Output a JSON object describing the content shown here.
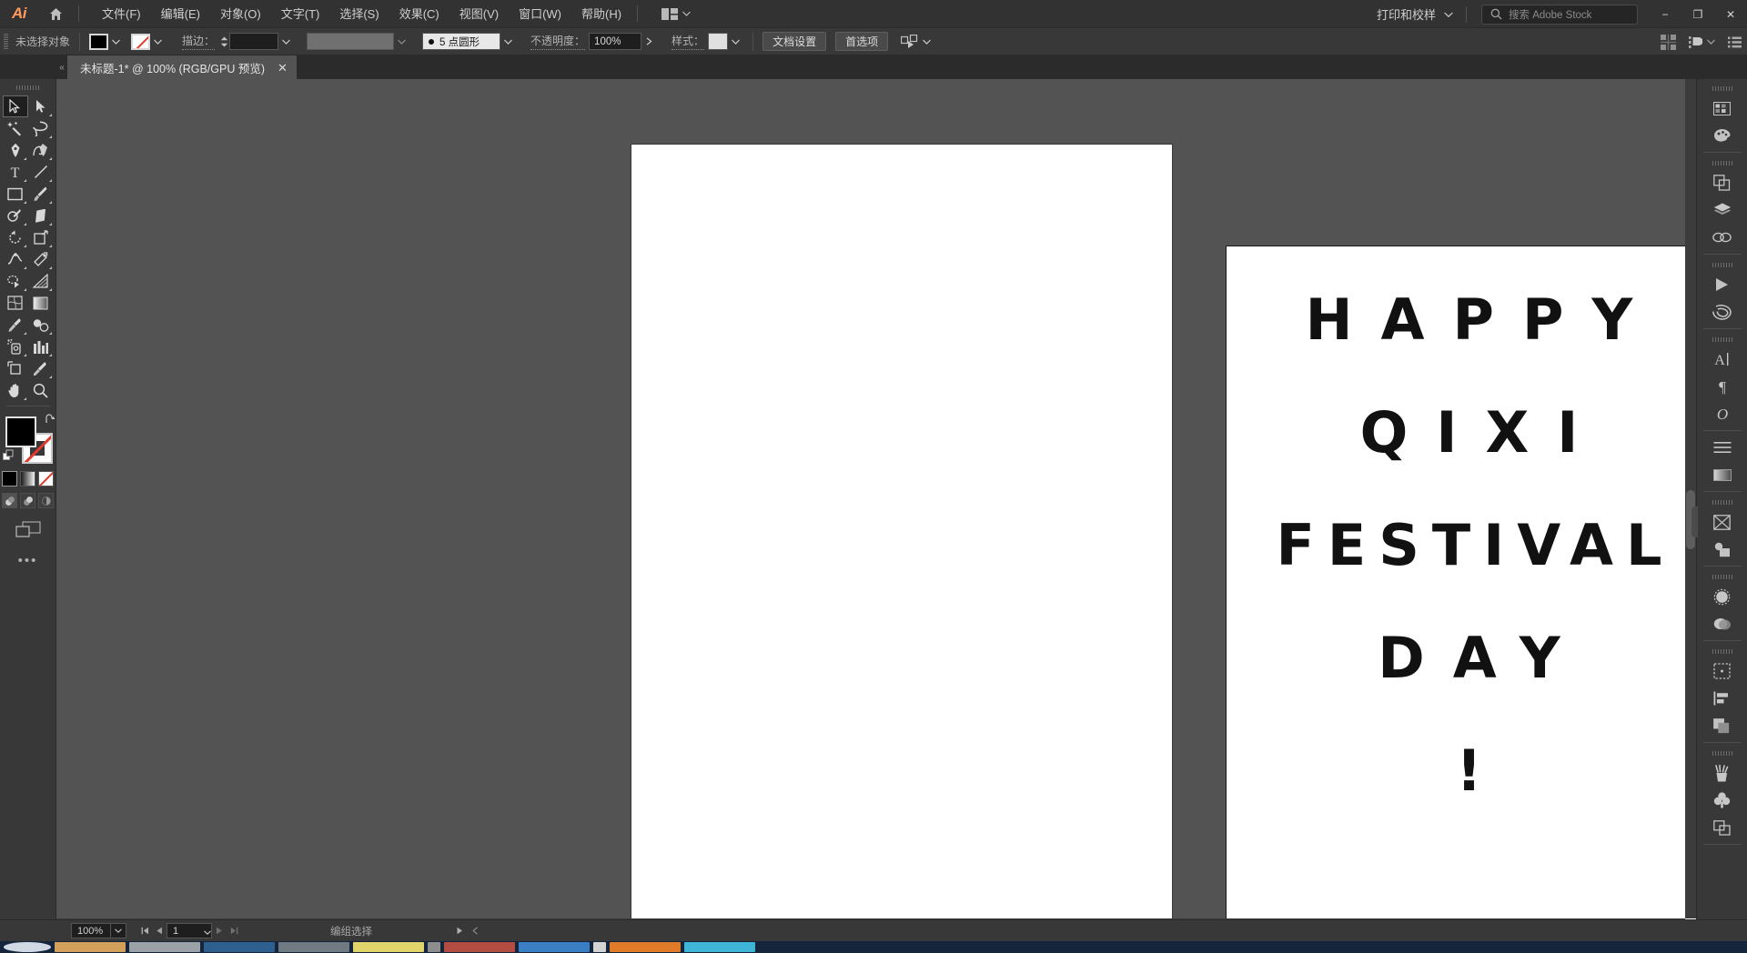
{
  "app": {
    "name": "Ai",
    "logo_color": "#ff9a5c"
  },
  "menubar": {
    "home_icon": "home-icon",
    "items": [
      {
        "label": "文件(F)"
      },
      {
        "label": "编辑(E)"
      },
      {
        "label": "对象(O)"
      },
      {
        "label": "文字(T)"
      },
      {
        "label": "选择(S)"
      },
      {
        "label": "效果(C)"
      },
      {
        "label": "视图(V)"
      },
      {
        "label": "窗口(W)"
      },
      {
        "label": "帮助(H)"
      }
    ],
    "arrange_icon": "arrange-documents-icon",
    "workspace": "打印和校样",
    "search_placeholder": "搜索 Adobe Stock",
    "search_icon": "search-icon",
    "window_controls": {
      "minimize": "−",
      "restore": "❐",
      "close": "✕"
    }
  },
  "controlbar": {
    "selection_label": "未选择对象",
    "fill_swatch": "#000000",
    "stroke_swatch": "none",
    "stroke_label": "描边：",
    "stroke_weight": "",
    "variable_width_profile": "",
    "brush_definition": "5 点圆形",
    "opacity_label": "不透明度：",
    "opacity_value": "100%",
    "style_label": "样式：",
    "document_setup": "文档设置",
    "preferences": "首选项",
    "select_similar_icon": "select-similar-objects-icon",
    "align_icon": "align-icon",
    "arrange_icon": "arrange-objects-icon",
    "options_icon": "panel-options-icon"
  },
  "tabbar": {
    "collapse_icon": "collapse-icon",
    "tabs": [
      {
        "title": "未标题-1* @ 100% (RGB/GPU 预览)",
        "close": "✕",
        "active": true
      }
    ]
  },
  "toolbar": {
    "tools": [
      {
        "name": "selection-tool",
        "active": true
      },
      {
        "name": "direct-selection-tool",
        "active": false
      },
      {
        "name": "magic-wand-tool",
        "active": false
      },
      {
        "name": "lasso-tool",
        "active": false
      },
      {
        "name": "pen-tool",
        "active": false
      },
      {
        "name": "curvature-tool",
        "active": false
      },
      {
        "name": "type-tool",
        "active": false
      },
      {
        "name": "line-segment-tool",
        "active": false
      },
      {
        "name": "rectangle-tool",
        "active": false
      },
      {
        "name": "paintbrush-tool",
        "active": false
      },
      {
        "name": "shaper-tool",
        "active": false
      },
      {
        "name": "eraser-tool",
        "active": false
      },
      {
        "name": "rotate-tool",
        "active": false
      },
      {
        "name": "scale-tool",
        "active": false
      },
      {
        "name": "width-tool",
        "active": false
      },
      {
        "name": "free-transform-tool",
        "active": false
      },
      {
        "name": "shape-builder-tool",
        "active": false
      },
      {
        "name": "perspective-grid-tool",
        "active": false
      },
      {
        "name": "mesh-tool",
        "active": false
      },
      {
        "name": "gradient-tool",
        "active": false
      },
      {
        "name": "eyedropper-tool",
        "active": false
      },
      {
        "name": "blend-tool",
        "active": false
      },
      {
        "name": "symbol-sprayer-tool",
        "active": false
      },
      {
        "name": "column-graph-tool",
        "active": false
      },
      {
        "name": "artboard-tool",
        "active": false
      },
      {
        "name": "slice-tool",
        "active": false
      },
      {
        "name": "hand-tool",
        "active": false
      },
      {
        "name": "zoom-tool",
        "active": false
      }
    ],
    "fill_color": "#000000",
    "stroke_color": "none",
    "swap_icon": "swap-fill-stroke-icon",
    "default_icon": "default-fill-stroke-icon",
    "color_modes": [
      {
        "name": "color-mode-solid",
        "active": true
      },
      {
        "name": "color-mode-gradient",
        "active": false
      },
      {
        "name": "color-mode-none",
        "active": false
      }
    ],
    "draw_modes": [
      {
        "name": "draw-normal-mode",
        "active": true
      },
      {
        "name": "draw-behind-mode",
        "active": false
      },
      {
        "name": "draw-inside-mode",
        "active": false
      }
    ],
    "screen_mode_icon": "change-screen-mode-icon",
    "more_icon": "edit-toolbar-icon",
    "more_label": "•••"
  },
  "canvas": {
    "background": "#535353",
    "paper_color": "#ffffff",
    "artboard_stroke": "#1a1a1a",
    "artwork": {
      "lines": [
        {
          "text": "HAPPY"
        },
        {
          "text": "QIXI"
        },
        {
          "text": "FESTIVAL"
        },
        {
          "text": "DAY"
        },
        {
          "text": "!"
        }
      ],
      "color": "#111111"
    },
    "scrollbars": {
      "vertical": "vertical-scrollbar",
      "horizontal": "horizontal-scrollbar"
    }
  },
  "rightdock": {
    "groups": [
      {
        "icons": [
          {
            "name": "swatches-panel-icon"
          },
          {
            "name": "color-panel-icon"
          }
        ]
      },
      {
        "icons": [
          {
            "name": "pathfinder-panel-icon"
          },
          {
            "name": "layers-panel-icon"
          },
          {
            "name": "links-panel-icon"
          }
        ]
      },
      {
        "icons": [
          {
            "name": "actions-panel-icon"
          },
          {
            "name": "symbols-panel-icon"
          }
        ]
      },
      {
        "icons": [
          {
            "name": "character-panel-icon"
          },
          {
            "name": "paragraph-panel-icon"
          },
          {
            "name": "glyphs-panel-icon"
          }
        ]
      },
      {
        "icons": [
          {
            "name": "align-panel-icon"
          },
          {
            "name": "gradient-panel-icon"
          }
        ]
      },
      {
        "icons": [
          {
            "name": "image-trace-panel-icon"
          },
          {
            "name": "transparency-panel-icon"
          }
        ]
      },
      {
        "icons": [
          {
            "name": "appearance-panel-icon"
          },
          {
            "name": "graphic-styles-panel-icon"
          }
        ]
      },
      {
        "icons": [
          {
            "name": "artboards-panel-icon"
          },
          {
            "name": "transform-panel-icon"
          },
          {
            "name": "pathfinder-shapes-icon"
          }
        ]
      },
      {
        "icons": [
          {
            "name": "brushes-panel-icon"
          },
          {
            "name": "symbols-library-icon"
          },
          {
            "name": "asset-export-panel-icon"
          }
        ]
      }
    ]
  },
  "statusbar": {
    "zoom_level": "100%",
    "zoom_dropdown_icon": "chevron-down-icon",
    "first_page_icon": "first-artboard-icon",
    "prev_page_icon": "prev-artboard-icon",
    "page_number": "1",
    "page_dropdown_icon": "chevron-down-icon",
    "next_page_icon": "next-artboard-icon",
    "last_page_icon": "last-artboard-icon",
    "status_text": "编组选择",
    "status_menu_icon": "status-menu-icon",
    "resize_icon": "resize-grip-icon"
  },
  "taskbar": {
    "background": "#14253c",
    "items": [
      {
        "color": "#cfd8e3"
      },
      {
        "color": "#d2a05a"
      },
      {
        "color": "#9aa2a8"
      },
      {
        "color": "#2d5f8f"
      },
      {
        "color": "#6f7a82"
      },
      {
        "color": "#e0d46a"
      },
      {
        "color": "#8d8d8d"
      },
      {
        "color": "#b34d42"
      },
      {
        "color": "#3a7fc4"
      },
      {
        "color": "#d3d3d3"
      },
      {
        "color": "#e07b2a"
      },
      {
        "color": "#3fb5d8"
      }
    ]
  }
}
